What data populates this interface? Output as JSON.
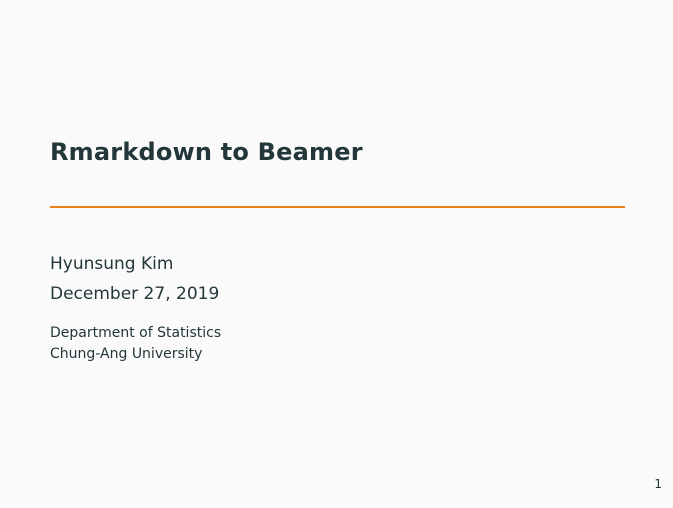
{
  "slide": {
    "title": "Rmarkdown to Beamer",
    "author": "Hyunsung Kim",
    "date": "December 27, 2019",
    "institute": [
      "Department of Statistics",
      "Chung-Ang University"
    ],
    "page_number": "1"
  },
  "colors": {
    "text": "#23373b",
    "accent": "#eb811b",
    "background": "#fafafa"
  }
}
